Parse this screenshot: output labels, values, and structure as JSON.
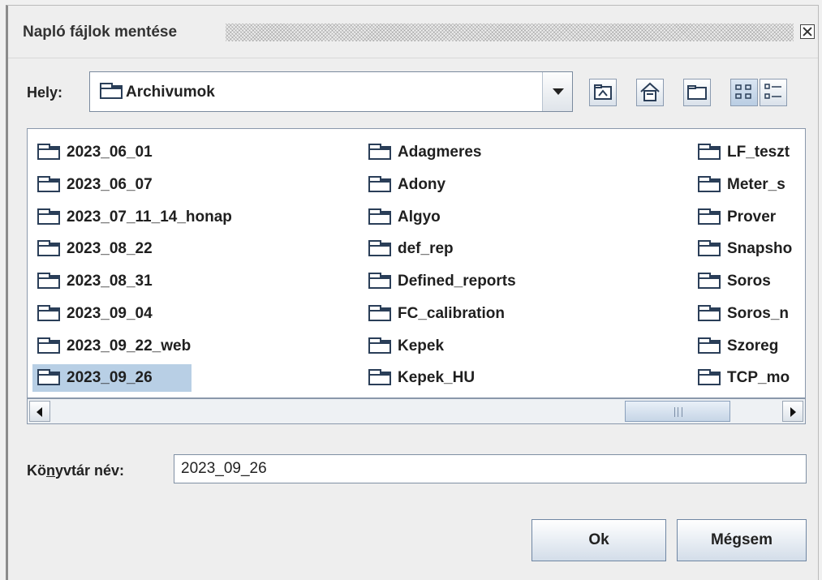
{
  "dialog": {
    "title": "Napló fájlok mentése",
    "close_icon": "close-icon"
  },
  "location": {
    "label": "Hely:",
    "current": "Archivumok",
    "folder_icon": "folder-icon"
  },
  "toolbar": {
    "buttons": [
      {
        "name": "up-one-level",
        "icon": "up-folder-icon"
      },
      {
        "name": "home",
        "icon": "home-icon"
      },
      {
        "name": "new-folder",
        "icon": "new-folder-icon"
      },
      {
        "name": "list-view",
        "icon": "list-view-icon",
        "pressed": true
      },
      {
        "name": "details-view",
        "icon": "details-view-icon"
      }
    ]
  },
  "files": {
    "columns": [
      [
        "2023_06_01",
        "2023_06_07",
        "2023_07_11_14_honap",
        "2023_08_22",
        "2023_08_31",
        "2023_09_04",
        "2023_09_22_web",
        "2023_09_26"
      ],
      [
        "Adagmeres",
        "Adony",
        "Algyo",
        "def_rep",
        "Defined_reports",
        "FC_calibration",
        "Kepek",
        "Kepek_HU"
      ],
      [
        "LF_teszt",
        "Meter_s",
        "Prover",
        "Snapsho",
        "Soros",
        "Soros_n",
        "Szoreg",
        "TCP_mo"
      ]
    ],
    "selected": "2023_09_26",
    "selection_color": "#b8cfe5"
  },
  "folder_name": {
    "label_before": "Kö",
    "label_underlined": "n",
    "label_after": "yvtár név:",
    "value": "2023_09_26"
  },
  "buttons": {
    "ok": "Ok",
    "cancel": "Mégsem"
  }
}
